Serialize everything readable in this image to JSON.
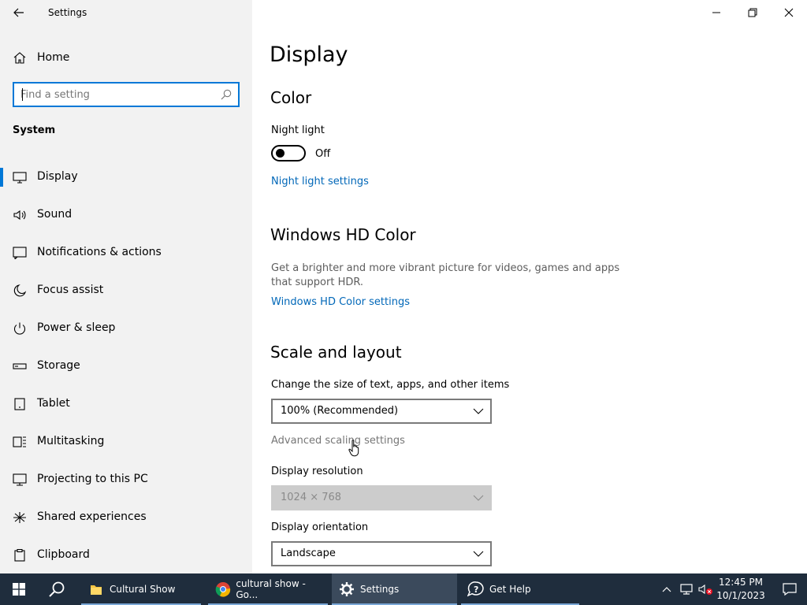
{
  "window": {
    "title": "Settings"
  },
  "sidebar": {
    "home_label": "Home",
    "search_placeholder": "Find a setting",
    "section_label": "System",
    "items": [
      {
        "label": "Display",
        "icon": "monitor-icon",
        "active": true
      },
      {
        "label": "Sound",
        "icon": "speaker-icon"
      },
      {
        "label": "Notifications & actions",
        "icon": "notification-icon"
      },
      {
        "label": "Focus assist",
        "icon": "moon-icon"
      },
      {
        "label": "Power & sleep",
        "icon": "power-icon"
      },
      {
        "label": "Storage",
        "icon": "storage-icon"
      },
      {
        "label": "Tablet",
        "icon": "tablet-icon"
      },
      {
        "label": "Multitasking",
        "icon": "multitasking-icon"
      },
      {
        "label": "Projecting to this PC",
        "icon": "projecting-icon"
      },
      {
        "label": "Shared experiences",
        "icon": "shared-experiences-icon"
      },
      {
        "label": "Clipboard",
        "icon": "clipboard-icon"
      }
    ]
  },
  "main": {
    "page_title": "Display",
    "color": {
      "heading": "Color",
      "night_light_label": "Night light",
      "night_light_state": "Off",
      "night_light_link": "Night light settings"
    },
    "hd_color": {
      "heading": "Windows HD Color",
      "description": "Get a brighter and more vibrant picture for videos, games and apps that support HDR.",
      "link": "Windows HD Color settings"
    },
    "scale_layout": {
      "heading": "Scale and layout",
      "size_label": "Change the size of text, apps, and other items",
      "size_value": "100% (Recommended)",
      "advanced_link": "Advanced scaling settings",
      "resolution_label": "Display resolution",
      "resolution_value": "1024 × 768",
      "orientation_label": "Display orientation",
      "orientation_value": "Landscape"
    }
  },
  "taskbar": {
    "apps": [
      {
        "label": "Cultural Show",
        "icon": "folder-icon"
      },
      {
        "label": "cultural show - Go...",
        "icon": "chrome-icon"
      },
      {
        "label": "Settings",
        "icon": "gear-icon",
        "active": true
      },
      {
        "label": "Get Help",
        "icon": "help-icon"
      }
    ],
    "time": "12:45 PM",
    "date": "10/1/2023"
  },
  "colors": {
    "accent": "#0078d7",
    "link": "#0067b8",
    "sidebar_bg": "#f2f2f2",
    "taskbar_bg": "#1f2d3d"
  }
}
